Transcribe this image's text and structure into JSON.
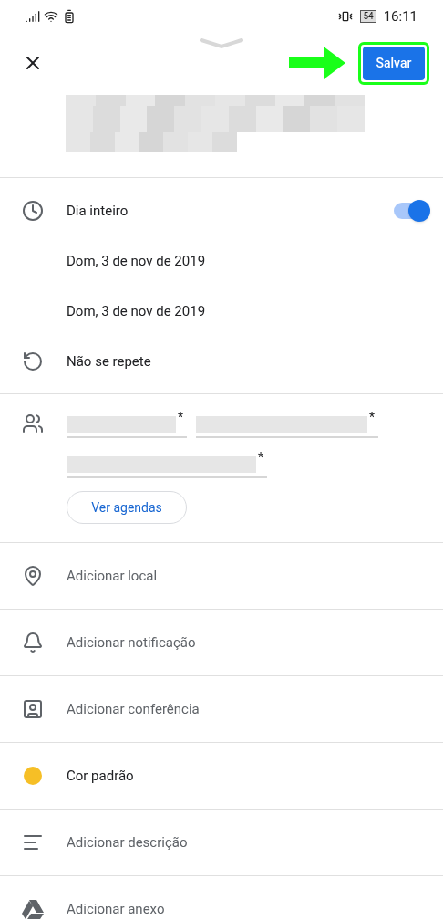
{
  "status_bar": {
    "battery": "54",
    "time": "16:11"
  },
  "header": {
    "save_label": "Salvar"
  },
  "all_day": {
    "label": "Dia inteiro",
    "on": true
  },
  "dates": [
    "Dom, 3 de nov de 2019",
    "Dom, 3 de nov de 2019"
  ],
  "repeat": {
    "label": "Não se repete"
  },
  "guests": [
    {
      "mark": "*"
    },
    {
      "mark": "*"
    },
    {
      "mark": "*"
    }
  ],
  "calendars_button": "Ver agendas",
  "options": [
    {
      "kind": "location",
      "label": "Adicionar local"
    },
    {
      "kind": "notification",
      "label": "Adicionar notificação"
    },
    {
      "kind": "conference",
      "label": "Adicionar conferência"
    },
    {
      "kind": "color",
      "label": "Cor padrão",
      "color": "#f6bf26"
    },
    {
      "kind": "description",
      "label": "Adicionar descrição"
    },
    {
      "kind": "attachment",
      "label": "Adicionar anexo"
    }
  ]
}
